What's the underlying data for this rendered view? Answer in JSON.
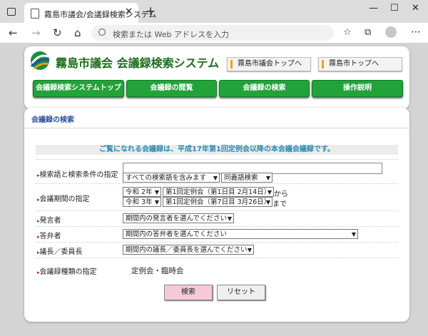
{
  "browser": {
    "tab_title": "霧島市議会/会議録検索システム",
    "address_placeholder": "検索または Web アドレスを入力"
  },
  "site": {
    "title": "霧島市議会  会議録検索システム",
    "top_links": [
      "霧島市議会トップへ",
      "霧島市トップへ"
    ],
    "nav": [
      "会議録検索システムトップ",
      "会議録の閲覧",
      "会議録の検索",
      "操作説明"
    ],
    "colors": {
      "nav_green": "#22a33a",
      "title_green": "#1d6e1d",
      "panel_title_blue": "#2a4f9c",
      "notice_blue": "#2a8ab4"
    }
  },
  "search": {
    "panel_title": "会議録の検索",
    "notice": "ご覧になれる会議録は、平成17年第1回定例会以降の本会議会議録です。",
    "keyword": {
      "label": "検索語と検索条件の指定",
      "value": "",
      "condition": "すべての検索語を含みます",
      "mode": "同義語検索"
    },
    "period": {
      "label": "会議期間の指定",
      "from_year": "令和 2年",
      "from_session": "第1回定例会（第1日目 2月14日）",
      "from_suffix": "から",
      "to_year": "令和 3年",
      "to_session": "第1回定例会（第7日目 3月26日）",
      "to_suffix": "まで"
    },
    "speaker": {
      "label": "発言者",
      "value": "期間内の発言者を選んでください"
    },
    "respondent": {
      "label": "答弁者",
      "value": "期間内の答弁者を選んでください"
    },
    "chair": {
      "label": "議長／委員長",
      "value": "期間内の議長／委員長を選んでください"
    },
    "meeting_type": {
      "label": "会議録種類の指定",
      "value": "定例会・臨時会"
    },
    "buttons": {
      "search": "検索",
      "reset": "リセット"
    }
  }
}
